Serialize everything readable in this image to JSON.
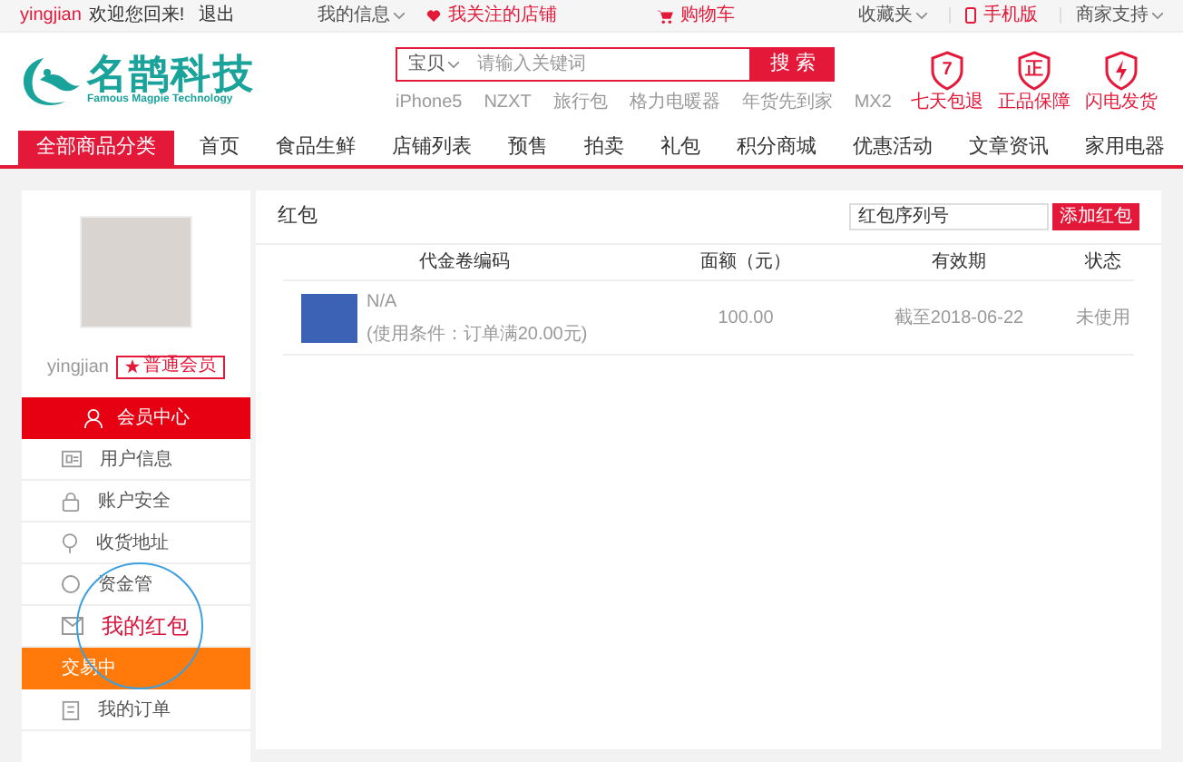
{
  "top_bar": {
    "user": "yingjian",
    "welcome": "欢迎您回来!",
    "logout": "退出",
    "links": [
      {
        "label": "我的信息",
        "kind": "dropdown"
      },
      {
        "label": "我关注的店铺",
        "kind": "heart"
      },
      {
        "label": "购物车",
        "kind": "cart"
      },
      {
        "label": "收藏夹",
        "kind": "dropdown"
      },
      {
        "label": "手机版",
        "kind": "phone"
      },
      {
        "label": "商家支持",
        "kind": "dropdown"
      }
    ]
  },
  "header": {
    "logo_name": "名鹊科技",
    "logo_subtitle": "Famous Magpie Technology",
    "search": {
      "scope": "宝贝",
      "placeholder": "请输入关键词",
      "button": "搜 索",
      "hot": [
        "iPhone5",
        "NZXT",
        "旅行包",
        "格力电暖器",
        "年货先到家",
        "MX2"
      ]
    },
    "badges": [
      {
        "kind": "glyph",
        "glyph": "7",
        "label": "七天包退"
      },
      {
        "kind": "glyph",
        "glyph": "正",
        "label": "正品保障"
      },
      {
        "kind": "bolt",
        "label": "闪电发货"
      }
    ]
  },
  "nav": {
    "category": "全部商品分类",
    "items": [
      "首页",
      "食品生鲜",
      "店铺列表",
      "预售",
      "拍卖",
      "礼包",
      "积分商城",
      "优惠活动",
      "文章资讯",
      "家用电器"
    ]
  },
  "sidebar": {
    "username": "yingjian",
    "member_level": "普通会员",
    "items": [
      {
        "label": "会员中心",
        "kind": "header",
        "selected": false
      },
      {
        "label": "用户信息",
        "kind": "item",
        "selected": false
      },
      {
        "label": "账户安全",
        "kind": "item",
        "selected": false
      },
      {
        "label": "收货地址",
        "kind": "item",
        "selected": false
      },
      {
        "label": "资金管",
        "kind": "item",
        "selected": false
      },
      {
        "label": "我的红包",
        "kind": "item",
        "selected": true
      },
      {
        "label": "交易中",
        "kind": "section",
        "selected": false
      },
      {
        "label": "我的订单",
        "kind": "item",
        "selected": false
      }
    ]
  },
  "content": {
    "title": "红包",
    "serial_field": {
      "value": "红包序列号"
    },
    "add_button": "添加红包",
    "table": {
      "columns": [
        "代金卷编码",
        "面额（元）",
        "有效期",
        "状态"
      ],
      "rows": [
        {
          "code": "N/A",
          "condition": "(使用条件：订单满20.00元)",
          "amount": "100.00",
          "validity": "截至2018-06-22",
          "status": "未使用"
        }
      ]
    }
  }
}
